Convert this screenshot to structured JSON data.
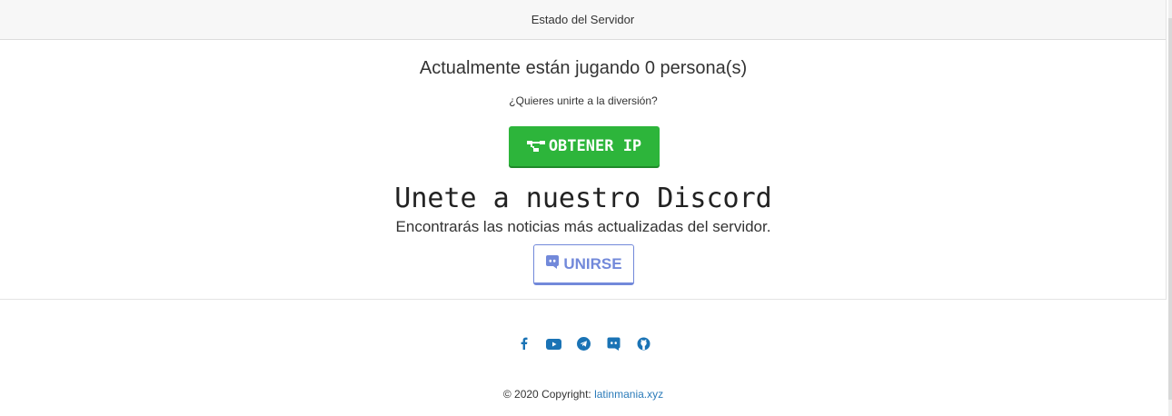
{
  "header": {
    "title": "Estado del Servidor"
  },
  "status": {
    "players_text": "Actualmente están jugando 0 persona(s)",
    "question": "¿Quieres unirte a la diversión?",
    "ip_button_label": "OBTENER IP"
  },
  "discord": {
    "title": "Unete a nuestro Discord",
    "description": "Encontrarás las noticias más actualizadas del servidor.",
    "join_button_label": "UNIRSE",
    "color": "#7289da"
  },
  "socials": [
    {
      "icon": "facebook-icon"
    },
    {
      "icon": "youtube-icon"
    },
    {
      "icon": "telegram-icon"
    },
    {
      "icon": "discord-icon"
    },
    {
      "icon": "github-icon"
    }
  ],
  "footer": {
    "copyright": "© 2020 Copyright: ",
    "link_text": "latinmania.xyz"
  },
  "colors": {
    "ip_button": "#2db53b",
    "social_icons": "#1a73b5",
    "link": "#2b7bb9"
  }
}
